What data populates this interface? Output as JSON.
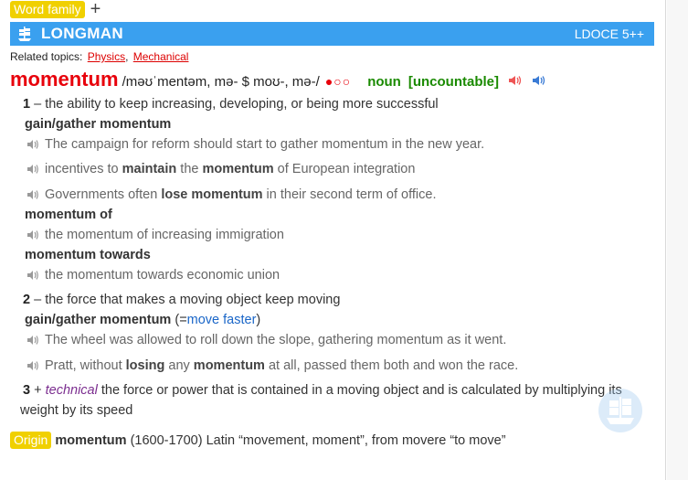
{
  "topbar": {
    "word_family": "Word family",
    "plus": "+"
  },
  "header": {
    "brand": "LONGMAN",
    "edition": "LDOCE 5++"
  },
  "related": {
    "label": "Related topics:",
    "topics": [
      "Physics",
      "Mechanical"
    ],
    "sep": ","
  },
  "entry": {
    "headword": "momentum",
    "pronunciation": "/məʊˈmentəm, mə- $ moʊ-, mə-/",
    "frequency": "●○○",
    "pos": "noun",
    "grammar": "[uncountable]"
  },
  "senses": [
    {
      "num": "1",
      "dash": "–",
      "definition": "the ability to keep increasing, developing, or being more successful",
      "colloc1": "gain/gather momentum",
      "ex1": "The campaign for reform should start to gather momentum in the new year.",
      "ex2_a": "incentives to ",
      "ex2_b": "maintain",
      "ex2_c": " the ",
      "ex2_d": "momentum",
      "ex2_e": " of European integration",
      "ex3_a": "Governments often ",
      "ex3_b": "lose momentum",
      "ex3_c": " in their second term of office.",
      "colloc2": "momentum of",
      "ex4": "the momentum of increasing immigration",
      "colloc3": "momentum towards",
      "ex5": "the momentum towards economic union"
    },
    {
      "num": "2",
      "dash": "–",
      "definition": "the force that makes a moving object keep moving",
      "colloc1": "gain/gather momentum",
      "syn_open": "(=",
      "syn": "move faster",
      "syn_close": ")",
      "ex1": "The wheel was allowed to roll down the slope, gathering momentum as it went.",
      "ex2_a": "Pratt, without ",
      "ex2_b": "losing",
      "ex2_c": " any ",
      "ex2_d": "momentum",
      "ex2_e": " at all, passed them both and won the race."
    },
    {
      "num": "3",
      "plus": "+",
      "register": "technical",
      "definition_line1": "the force or power that is contained in a moving object and is calculated by multiplying its",
      "definition_line2": "weight by its speed"
    }
  ],
  "origin": {
    "label": "Origin",
    "word": "momentum",
    "text": "(1600-1700) Latin “movement, moment”, from movere “to move”"
  },
  "colors": {
    "headword": "#e8000b",
    "header_bg": "#3aa0ef",
    "pos": "#1a8a00",
    "tag": "#f0d000"
  }
}
